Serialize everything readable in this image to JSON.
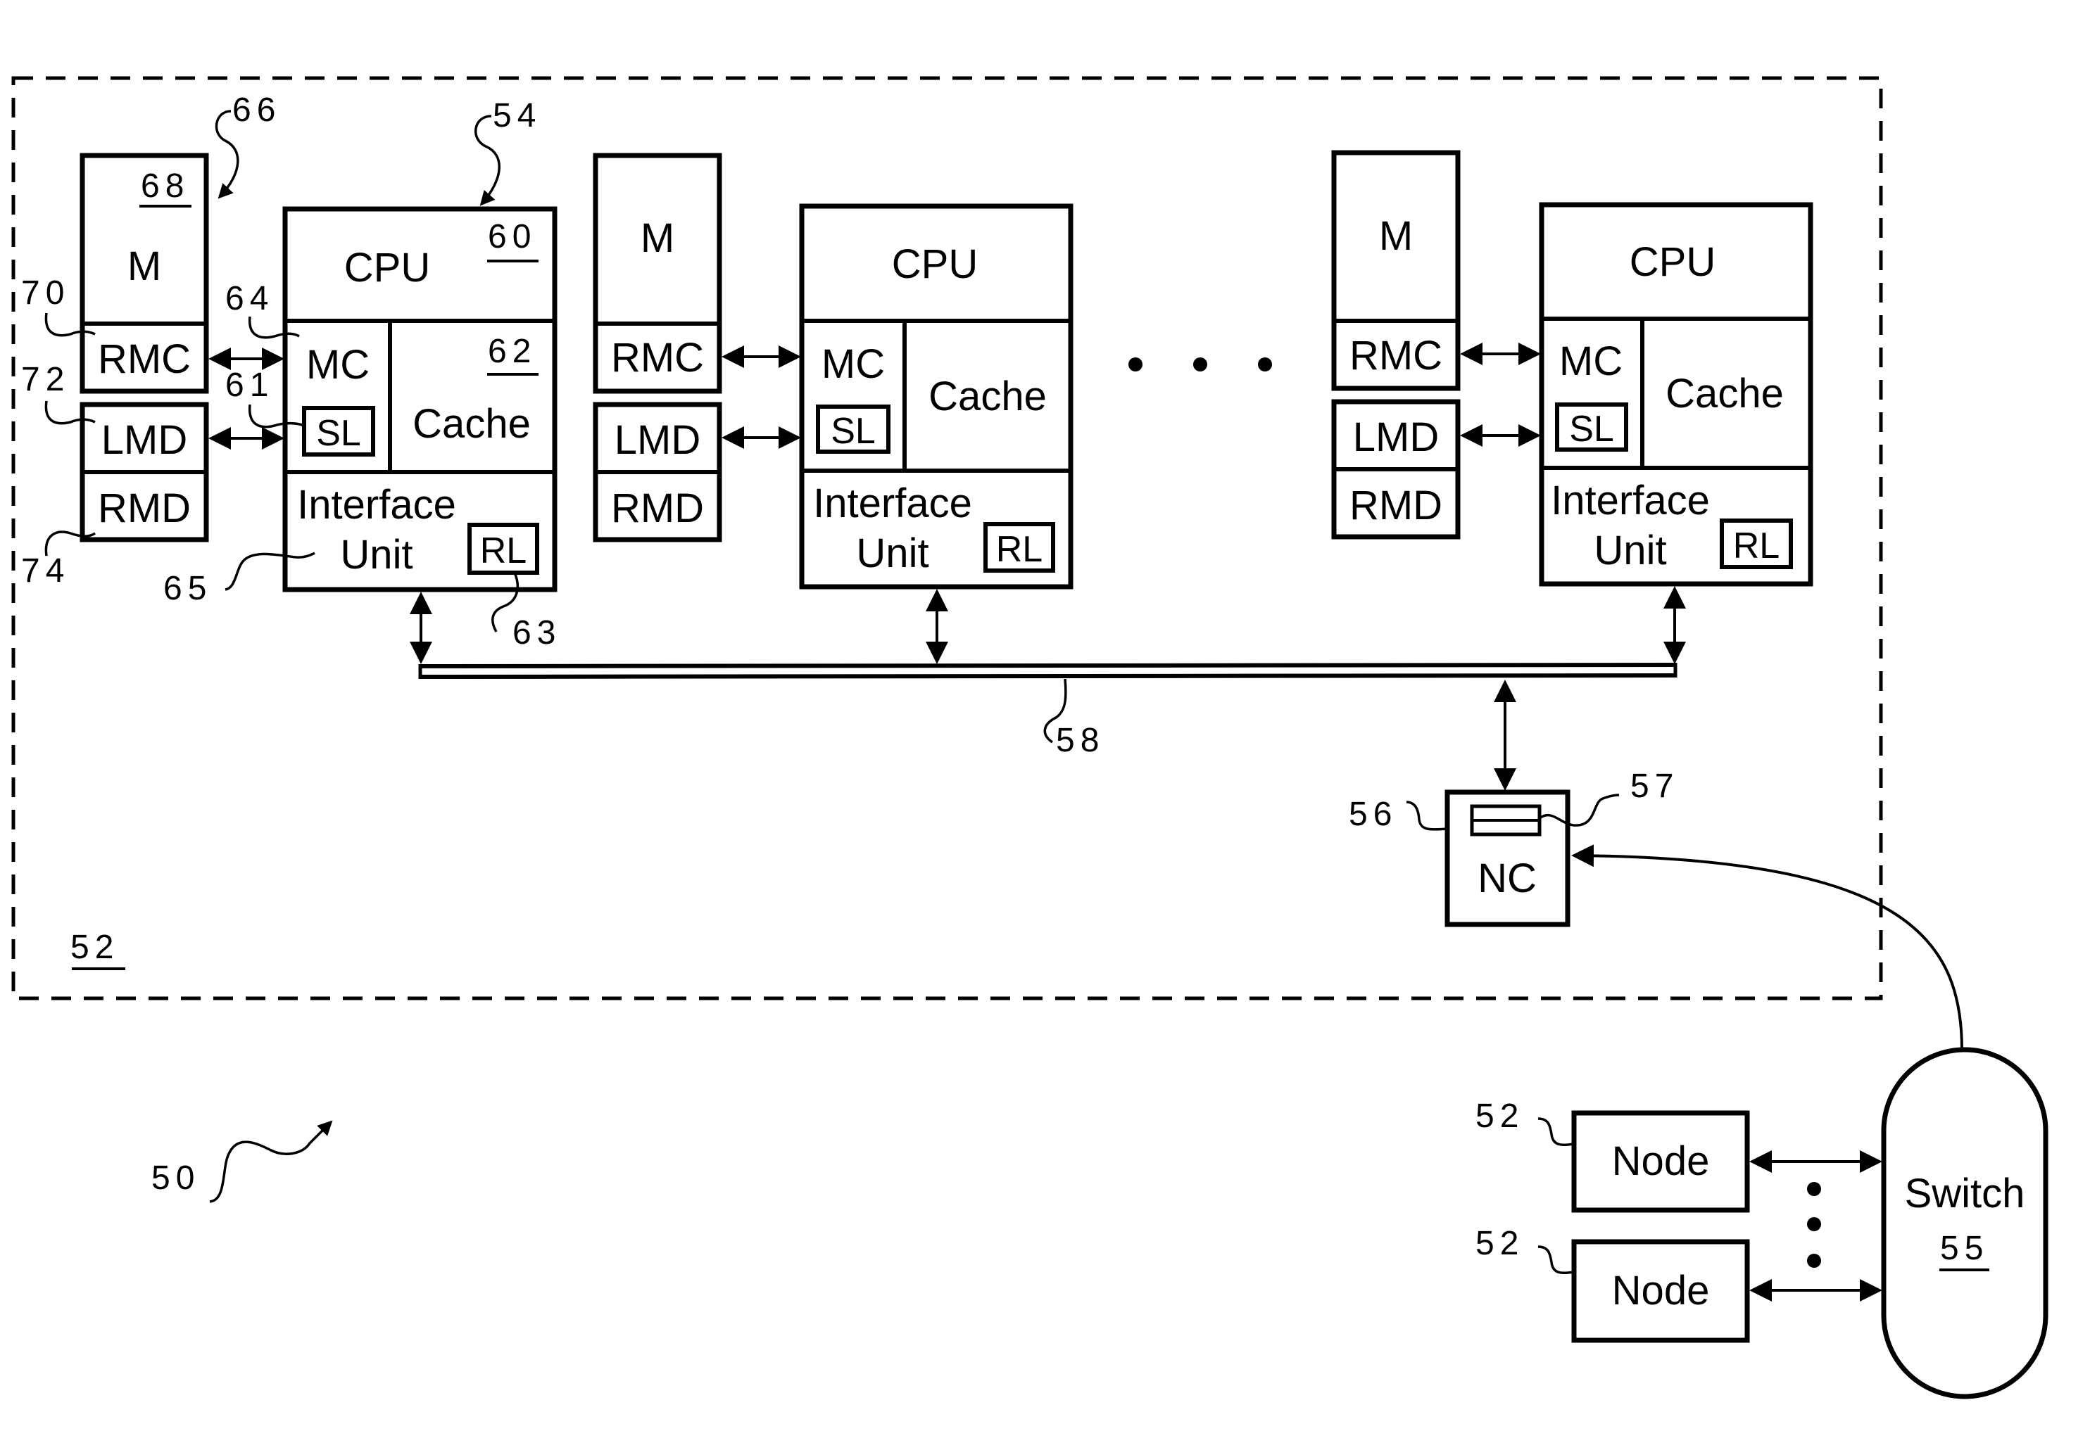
{
  "figure": {
    "system_ref": "50",
    "node_ref": "52",
    "dots": "• • •"
  },
  "processor_groups": [
    {
      "memory": {
        "label": "M",
        "ref": "68",
        "rmc": "RMC",
        "lmd": "LMD",
        "rmd": "RMD"
      },
      "cpu": {
        "label": "CPU",
        "ref": "60",
        "mc": "MC",
        "sl": "SL",
        "cache": "Cache",
        "cache_ref": "62",
        "iface_line1": "Interface",
        "iface_line2": "Unit",
        "rl": "RL"
      }
    },
    {
      "memory": {
        "label": "M",
        "rmc": "RMC",
        "lmd": "LMD",
        "rmd": "RMD"
      },
      "cpu": {
        "label": "CPU",
        "mc": "MC",
        "sl": "SL",
        "cache": "Cache",
        "iface_line1": "Interface",
        "iface_line2": "Unit",
        "rl": "RL"
      }
    },
    {
      "memory": {
        "label": "M",
        "rmc": "RMC",
        "lmd": "LMD",
        "rmd": "RMD"
      },
      "cpu": {
        "label": "CPU",
        "mc": "MC",
        "sl": "SL",
        "cache": "Cache",
        "iface_line1": "Interface",
        "iface_line2": "Unit",
        "rl": "RL"
      }
    }
  ],
  "reference_labels": {
    "memory_group": "66",
    "processor": "54",
    "rmc": "70",
    "lmd": "72",
    "rmd": "74",
    "mc": "64",
    "sl": "61",
    "interface_unit": "65",
    "rl": "63",
    "bus": "58",
    "nc": "56",
    "nc_register": "57"
  },
  "network_controller": {
    "label": "NC"
  },
  "switch": {
    "label": "Switch",
    "ref": "55"
  },
  "external_nodes": [
    {
      "label": "Node",
      "ref": "52"
    },
    {
      "label": "Node",
      "ref": "52"
    }
  ]
}
